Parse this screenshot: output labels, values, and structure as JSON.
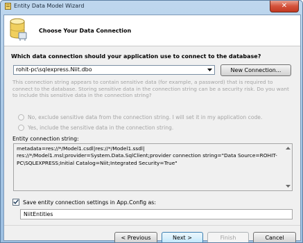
{
  "window": {
    "title": "Entity Data Model Wizard"
  },
  "header": {
    "title": "Choose Your Data Connection"
  },
  "question": "Which data connection should your application use to connect to the database?",
  "connection": {
    "selected": "rohit-pc\\sqlexpress.Niit.dbo",
    "new_button": "New Connection..."
  },
  "sensitive": {
    "info": "This connection string appears to contain sensitive data (for example, a password) that is required to connect to the database. Storing sensitive data in the connection string can be a security risk. Do you want to include this sensitive data in the connection string?",
    "option_no": "No, exclude sensitive data from the connection string. I will set it in my application code.",
    "option_yes": "Yes, include the sensitive data in the connection string."
  },
  "entity_connection": {
    "label": "Entity connection string:",
    "value": "metadata=res://*/Model1.csdl|res://*/Model1.ssdl|\nres://*/Model1.msl;provider=System.Data.SqlClient;provider connection string=\"Data Source=ROHIT-\nPC\\SQLEXPRESS;Initial Catalog=Niit;Integrated Security=True\""
  },
  "save_settings": {
    "label": "Save entity connection settings in App.Config as:",
    "checked": true,
    "value": "NiitEntities"
  },
  "buttons": {
    "previous": "< Previous",
    "next": "Next >",
    "finish": "Finish",
    "cancel": "Cancel"
  },
  "colors": {
    "frame": "#a9c8e6",
    "close": "#c23a22",
    "default_button_border": "#3c7fb1"
  }
}
